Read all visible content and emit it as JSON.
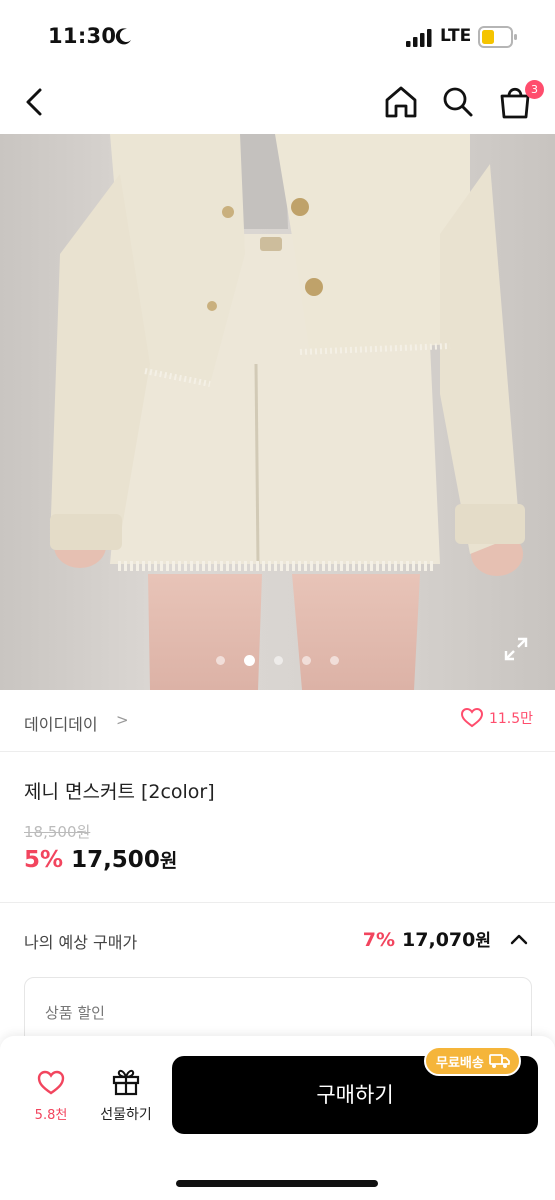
{
  "status_bar": {
    "time": "11:30",
    "network": "LTE",
    "icons": [
      "moon-icon",
      "signal-icon",
      "battery-icon"
    ]
  },
  "nav": {
    "icons": [
      "back-icon",
      "home-icon",
      "search-icon",
      "shopping-bag-icon"
    ],
    "cart_count": "3"
  },
  "gallery": {
    "image_count": 5,
    "active_index": 1,
    "icons": [
      "expand-icon"
    ]
  },
  "brand": {
    "name": "데이디데이",
    "chevron": ">",
    "likes": "11.5만",
    "icons": [
      "heart-icon",
      "chevron-right-icon"
    ]
  },
  "product": {
    "title": "제니 면스커트 [2color]",
    "original_price": "18,500원",
    "discount": "5%",
    "price": "17,500",
    "currency": "원"
  },
  "estimate": {
    "label": "나의 예상 구매가",
    "discount": "7%",
    "price": "17,070",
    "currency": "원",
    "icons": [
      "chevron-up-icon"
    ]
  },
  "discount_box": {
    "label": "상품 할인"
  },
  "bottom_bar": {
    "wish_count": "5.8천",
    "gift_label": "선물하기",
    "buy_label": "구매하기",
    "shipping_badge": "무료배송",
    "icons": [
      "heart-icon",
      "gift-icon",
      "truck-icon"
    ]
  },
  "colors": {
    "accent": "#f2455e",
    "badge": "#ff4d6d",
    "shipping_badge": "#f5b53a",
    "buy_button": "#000000"
  }
}
